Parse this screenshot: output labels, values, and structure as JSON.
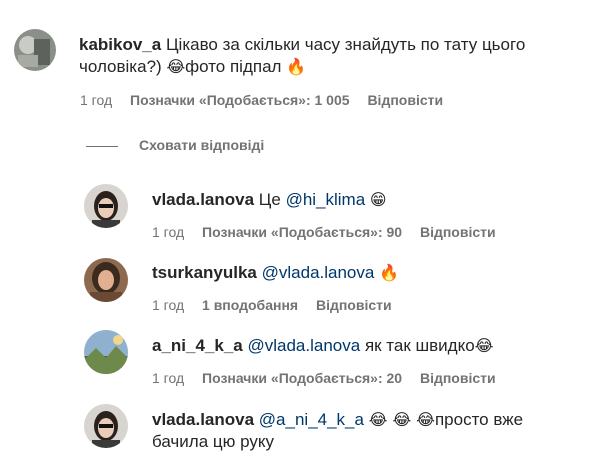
{
  "main_comment": {
    "username": "kabikov_a",
    "text_line1": "Цікаво за скільки часу знайдуть по тату цього",
    "text_line2a": "чоловіка?)",
    "emoji1": "😂",
    "text_line2b": "фото підпал",
    "emoji2": "🔥",
    "time": "1 год",
    "likes": "Позначки «Подобається»: 1 005",
    "reply": "Відповісти"
  },
  "hide_replies": "Сховати відповіді",
  "replies": [
    {
      "username": "vlada.lanova",
      "text_before": "Це",
      "mention": "@hi_klima",
      "emoji": "😁",
      "time": "1 год",
      "likes": "Позначки «Подобається»: 90",
      "reply": "Відповісти"
    },
    {
      "username": "tsurkanyulka",
      "mention": "@vlada.lanova",
      "emoji": "🔥",
      "time": "1 год",
      "likes": "1 вподобання",
      "reply": "Відповісти"
    },
    {
      "username": "a_ni_4_k_a",
      "mention": "@vlada.lanova",
      "text_after": "як так швидко",
      "emoji": "😂",
      "time": "1 год",
      "likes": "Позначки «Подобається»: 20",
      "reply": "Відповісти"
    },
    {
      "username": "vlada.lanova",
      "mention": "@a_ni_4_k_a",
      "emojis": "😂 😂 😂",
      "text_after": "просто вже",
      "text_line2": "бачила цю руку"
    }
  ],
  "colors": {
    "text": "#262626",
    "secondary": "#737373",
    "mention": "#00376b"
  }
}
